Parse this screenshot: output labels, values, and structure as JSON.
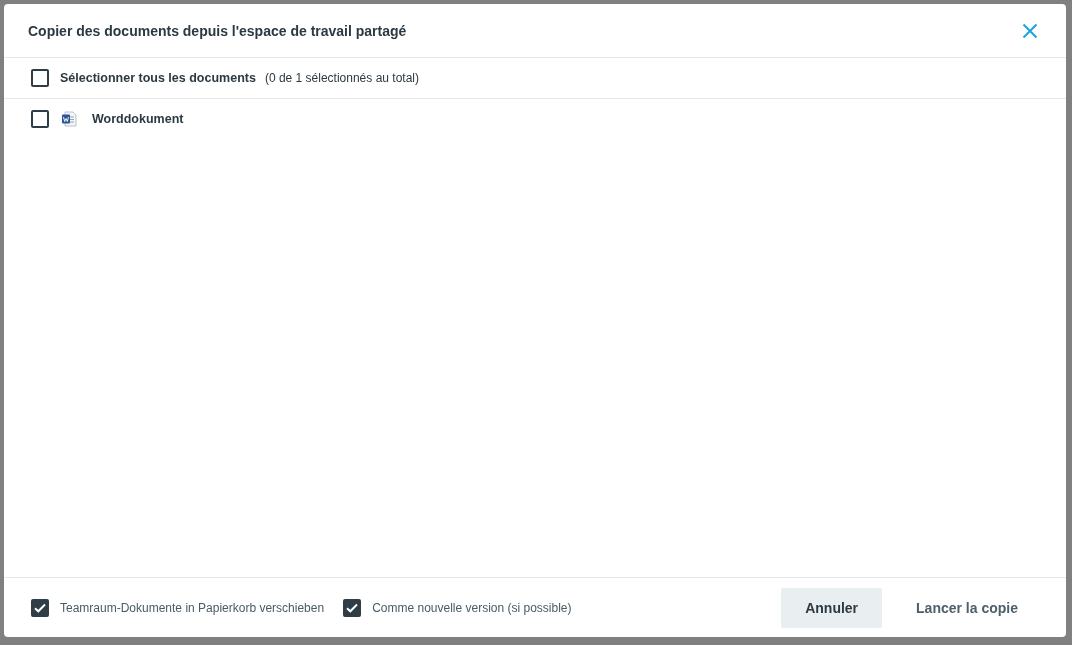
{
  "dialog": {
    "title": "Copier des documents depuis l'espace de travail partagé"
  },
  "select_all": {
    "label": "Sélectionner tous les documents",
    "count": "(0 de 1 sélectionnés au total)",
    "checked": false
  },
  "documents": [
    {
      "name": "Worddokument",
      "checked": false
    }
  ],
  "options": [
    {
      "label": "Teamraum-Dokumente in Papierkorb verschieben",
      "checked": true
    },
    {
      "label": "Comme nouvelle version (si possible)",
      "checked": true
    }
  ],
  "buttons": [
    {
      "label": "Annuler",
      "kind": "secondary"
    },
    {
      "label": "Lancer la copie",
      "kind": "text"
    }
  ]
}
